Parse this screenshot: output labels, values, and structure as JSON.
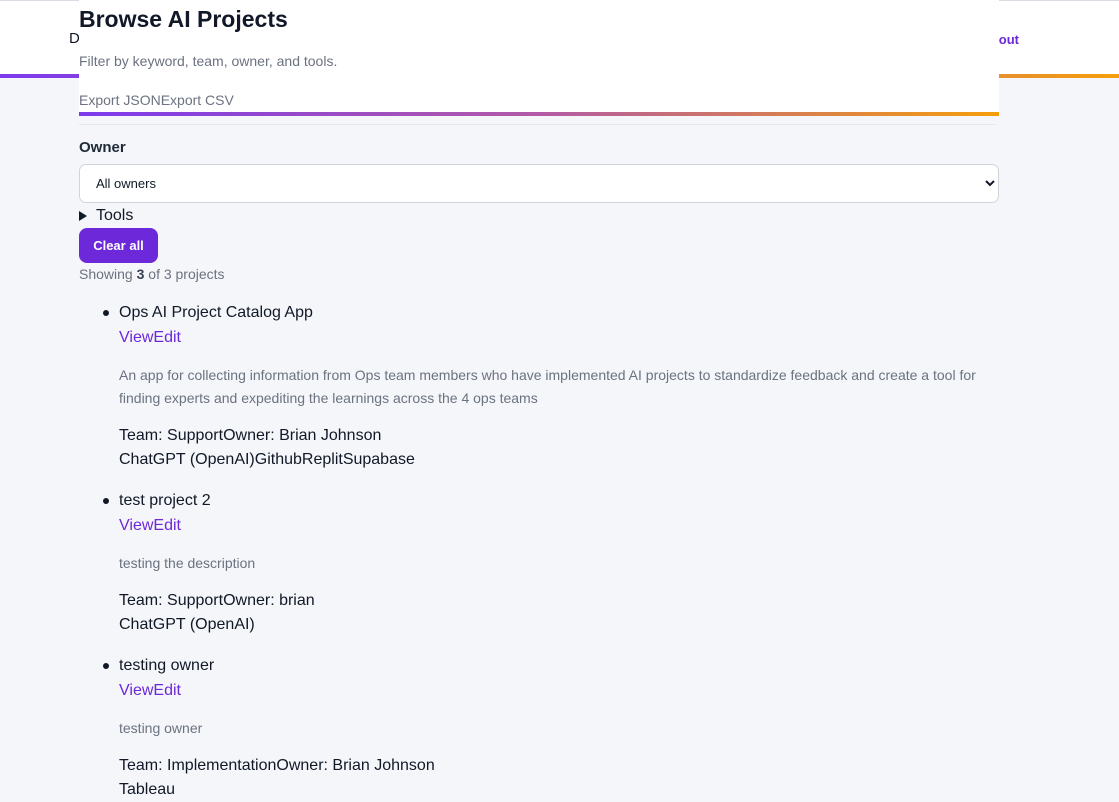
{
  "header": {
    "brand_initial": "D",
    "action_label": "out"
  },
  "page": {
    "title": "Browse AI Projects",
    "subtitle": "Filter by keyword, team, owner, and tools.",
    "export_json_label": "Export JSON",
    "export_csv_label": "Export CSV"
  },
  "filters": {
    "owner_label": "Owner",
    "owner_selected": "All owners",
    "tools_label": "Tools",
    "clear_label": "Clear all"
  },
  "results": {
    "prefix": "Showing",
    "shown": "3",
    "middle": "of 3 projects"
  },
  "projects": [
    {
      "name": "Ops AI Project Catalog App",
      "view_label": "View",
      "edit_label": "Edit",
      "description": "An app for collecting information from Ops team members who have implemented AI projects to standardize feedback and create a tool for finding experts and expediting the learnings across the 4 ops teams",
      "team": "Team: Support",
      "owner": "Owner: Brian Johnson",
      "tools": [
        "ChatGPT (OpenAI)",
        "Github",
        "Replit",
        "Supabase"
      ]
    },
    {
      "name": "test project 2",
      "view_label": "View",
      "edit_label": "Edit",
      "description": "testing the description",
      "team": "Team: Support",
      "owner": "Owner: brian",
      "tools": [
        "ChatGPT (OpenAI)"
      ]
    },
    {
      "name": "testing owner",
      "view_label": "View",
      "edit_label": "Edit",
      "description": "testing owner",
      "team": "Team: Implementation",
      "owner": "Owner: Brian Johnson",
      "tools": [
        "Tableau"
      ]
    }
  ],
  "colors": {
    "accent": "#6d28d9",
    "gradient_start": "#7c3aed",
    "gradient_end": "#f59e0b",
    "muted_text": "#6b7280"
  }
}
